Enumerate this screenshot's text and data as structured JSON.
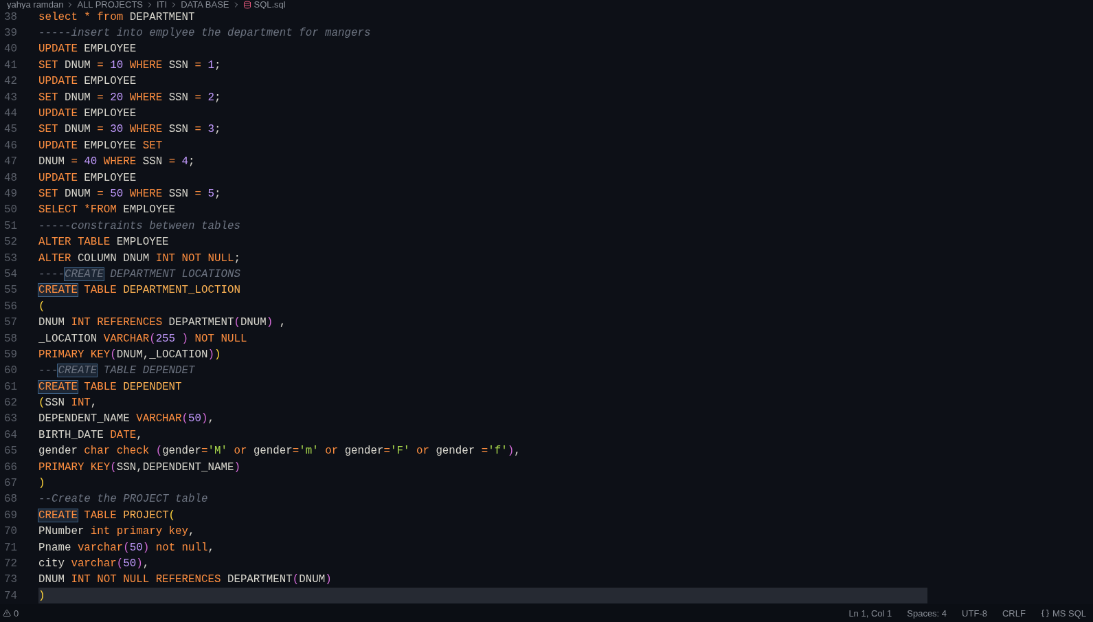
{
  "breadcrumb": [
    "yahya ramdan",
    "ALL PROJECTS",
    "ITI",
    "DATA BASE",
    "SQL.sql"
  ],
  "lines": [
    {
      "number": "38",
      "current": false,
      "tokens": [
        {
          "kind": "keyword",
          "text": "select * from"
        },
        {
          "kind": "ident",
          "text": " DEPARTMENT"
        }
      ]
    },
    {
      "number": "39",
      "current": false,
      "tokens": [
        {
          "kind": "comment",
          "text": "-----insert into emplyee the department for mangers"
        }
      ]
    },
    {
      "number": "40",
      "current": false,
      "tokens": [
        {
          "kind": "keyword",
          "text": "UPDATE"
        },
        {
          "kind": "ident",
          "text": " EMPLOYEE"
        }
      ]
    },
    {
      "number": "41",
      "current": false,
      "tokens": [
        {
          "kind": "keyword",
          "text": "SET"
        },
        {
          "kind": "ident",
          "text": " DNUM "
        },
        {
          "kind": "keyword",
          "text": "="
        },
        {
          "kind": "number",
          "text": " 10 "
        },
        {
          "kind": "keyword",
          "text": "WHERE"
        },
        {
          "kind": "ident",
          "text": " SSN "
        },
        {
          "kind": "keyword",
          "text": "="
        },
        {
          "kind": "number",
          "text": " 1"
        },
        {
          "kind": "ident",
          "text": ";"
        }
      ]
    },
    {
      "number": "42",
      "current": false,
      "tokens": [
        {
          "kind": "keyword",
          "text": "UPDATE"
        },
        {
          "kind": "ident",
          "text": " EMPLOYEE"
        }
      ]
    },
    {
      "number": "43",
      "current": false,
      "tokens": [
        {
          "kind": "keyword",
          "text": "SET"
        },
        {
          "kind": "ident",
          "text": " DNUM "
        },
        {
          "kind": "keyword",
          "text": "="
        },
        {
          "kind": "number",
          "text": " 20 "
        },
        {
          "kind": "keyword",
          "text": "WHERE"
        },
        {
          "kind": "ident",
          "text": " SSN "
        },
        {
          "kind": "keyword",
          "text": "="
        },
        {
          "kind": "number",
          "text": " 2"
        },
        {
          "kind": "ident",
          "text": ";"
        }
      ]
    },
    {
      "number": "44",
      "current": false,
      "tokens": [
        {
          "kind": "keyword",
          "text": "UPDATE"
        },
        {
          "kind": "ident",
          "text": " EMPLOYEE"
        }
      ]
    },
    {
      "number": "45",
      "current": false,
      "tokens": [
        {
          "kind": "keyword",
          "text": "SET"
        },
        {
          "kind": "ident",
          "text": " DNUM "
        },
        {
          "kind": "keyword",
          "text": "="
        },
        {
          "kind": "number",
          "text": " 30 "
        },
        {
          "kind": "keyword",
          "text": "WHERE"
        },
        {
          "kind": "ident",
          "text": " SSN "
        },
        {
          "kind": "keyword",
          "text": "="
        },
        {
          "kind": "number",
          "text": " 3"
        },
        {
          "kind": "ident",
          "text": ";"
        }
      ]
    },
    {
      "number": "46",
      "current": false,
      "tokens": [
        {
          "kind": "keyword",
          "text": "UPDATE"
        },
        {
          "kind": "ident",
          "text": " EMPLOYEE "
        },
        {
          "kind": "keyword",
          "text": "SET"
        }
      ]
    },
    {
      "number": "47",
      "current": false,
      "tokens": [
        {
          "kind": "ident",
          "text": "DNUM "
        },
        {
          "kind": "keyword",
          "text": "="
        },
        {
          "kind": "number",
          "text": " 40 "
        },
        {
          "kind": "keyword",
          "text": "WHERE"
        },
        {
          "kind": "ident",
          "text": " SSN "
        },
        {
          "kind": "keyword",
          "text": "="
        },
        {
          "kind": "number",
          "text": " 4"
        },
        {
          "kind": "ident",
          "text": ";"
        }
      ]
    },
    {
      "number": "48",
      "current": false,
      "tokens": [
        {
          "kind": "keyword",
          "text": "UPDATE"
        },
        {
          "kind": "ident",
          "text": " EMPLOYEE"
        }
      ]
    },
    {
      "number": "49",
      "current": false,
      "tokens": [
        {
          "kind": "keyword",
          "text": "SET"
        },
        {
          "kind": "ident",
          "text": " DNUM "
        },
        {
          "kind": "keyword",
          "text": "="
        },
        {
          "kind": "number",
          "text": " 50 "
        },
        {
          "kind": "keyword",
          "text": "WHERE"
        },
        {
          "kind": "ident",
          "text": " SSN "
        },
        {
          "kind": "keyword",
          "text": "="
        },
        {
          "kind": "number",
          "text": " 5"
        },
        {
          "kind": "ident",
          "text": ";"
        }
      ]
    },
    {
      "number": "50",
      "current": false,
      "tokens": [
        {
          "kind": "keyword",
          "text": "SELECT *FROM"
        },
        {
          "kind": "ident",
          "text": " EMPLOYEE"
        }
      ]
    },
    {
      "number": "51",
      "current": false,
      "tokens": [
        {
          "kind": "comment",
          "text": "-----constraints between tables"
        }
      ]
    },
    {
      "number": "52",
      "current": false,
      "tokens": [
        {
          "kind": "keyword",
          "text": "ALTER TABLE"
        },
        {
          "kind": "ident",
          "text": " EMPLOYEE"
        }
      ]
    },
    {
      "number": "53",
      "current": false,
      "tokens": [
        {
          "kind": "keyword",
          "text": "ALTER"
        },
        {
          "kind": "ident",
          "text": " COLUMN DNUM "
        },
        {
          "kind": "keyword",
          "text": "INT NOT NULL"
        },
        {
          "kind": "ident",
          "text": ";"
        }
      ]
    },
    {
      "number": "54",
      "current": false,
      "tokens": [
        {
          "kind": "comment",
          "text": "----"
        },
        {
          "kind": "comment-match",
          "text": "CREATE"
        },
        {
          "kind": "comment",
          "text": " DEPARTMENT LOCATIONS"
        }
      ]
    },
    {
      "number": "55",
      "current": false,
      "tokens": [
        {
          "kind": "keyword-match",
          "text": "CREATE"
        },
        {
          "kind": "keyword",
          "text": " TABLE "
        },
        {
          "kind": "name",
          "text": "DEPARTMENT_LOCTION"
        }
      ]
    },
    {
      "number": "56",
      "current": false,
      "tokens": [
        {
          "kind": "bracket-outer",
          "text": "("
        }
      ]
    },
    {
      "number": "57",
      "current": false,
      "tokens": [
        {
          "kind": "ident",
          "text": "DNUM "
        },
        {
          "kind": "keyword",
          "text": "INT REFERENCES"
        },
        {
          "kind": "ident",
          "text": " DEPARTMENT"
        },
        {
          "kind": "bracket-inner",
          "text": "("
        },
        {
          "kind": "ident",
          "text": "DNUM"
        },
        {
          "kind": "bracket-inner",
          "text": ")"
        },
        {
          "kind": "ident",
          "text": " ,"
        }
      ]
    },
    {
      "number": "58",
      "current": false,
      "tokens": [
        {
          "kind": "ident",
          "text": "_LOCATION "
        },
        {
          "kind": "keyword",
          "text": "VARCHAR"
        },
        {
          "kind": "bracket-inner",
          "text": "("
        },
        {
          "kind": "number",
          "text": "255 "
        },
        {
          "kind": "bracket-inner",
          "text": ")"
        },
        {
          "kind": "keyword",
          "text": " NOT NULL"
        }
      ]
    },
    {
      "number": "59",
      "current": false,
      "tokens": [
        {
          "kind": "keyword",
          "text": "PRIMARY KEY"
        },
        {
          "kind": "bracket-inner",
          "text": "("
        },
        {
          "kind": "ident",
          "text": "DNUM,_LOCATION"
        },
        {
          "kind": "bracket-inner",
          "text": ")"
        },
        {
          "kind": "bracket-outer",
          "text": ")"
        }
      ]
    },
    {
      "number": "60",
      "current": false,
      "tokens": [
        {
          "kind": "comment",
          "text": "---"
        },
        {
          "kind": "comment-match",
          "text": "CREATE"
        },
        {
          "kind": "comment",
          "text": " TABLE DEPENDET"
        }
      ]
    },
    {
      "number": "61",
      "current": false,
      "tokens": [
        {
          "kind": "keyword-match",
          "text": "CREATE"
        },
        {
          "kind": "keyword",
          "text": " TABLE "
        },
        {
          "kind": "name",
          "text": "DEPENDENT"
        }
      ]
    },
    {
      "number": "62",
      "current": false,
      "tokens": [
        {
          "kind": "bracket-outer",
          "text": "("
        },
        {
          "kind": "ident",
          "text": "SSN "
        },
        {
          "kind": "keyword",
          "text": "INT"
        },
        {
          "kind": "ident",
          "text": ","
        }
      ]
    },
    {
      "number": "63",
      "current": false,
      "tokens": [
        {
          "kind": "ident",
          "text": "DEPENDENT_NAME "
        },
        {
          "kind": "keyword",
          "text": "VARCHAR"
        },
        {
          "kind": "bracket-inner",
          "text": "("
        },
        {
          "kind": "number",
          "text": "50"
        },
        {
          "kind": "bracket-inner",
          "text": ")"
        },
        {
          "kind": "ident",
          "text": ","
        }
      ]
    },
    {
      "number": "64",
      "current": false,
      "tokens": [
        {
          "kind": "ident",
          "text": "BIRTH_DATE "
        },
        {
          "kind": "keyword",
          "text": "DATE"
        },
        {
          "kind": "ident",
          "text": ","
        }
      ]
    },
    {
      "number": "65",
      "current": false,
      "tokens": [
        {
          "kind": "ident",
          "text": "gender "
        },
        {
          "kind": "keyword",
          "text": "char check "
        },
        {
          "kind": "bracket-inner",
          "text": "("
        },
        {
          "kind": "ident",
          "text": "gender"
        },
        {
          "kind": "keyword",
          "text": "="
        },
        {
          "kind": "string",
          "text": "'M'"
        },
        {
          "kind": "keyword",
          "text": " or "
        },
        {
          "kind": "ident",
          "text": "gender"
        },
        {
          "kind": "keyword",
          "text": "="
        },
        {
          "kind": "string",
          "text": "'m'"
        },
        {
          "kind": "keyword",
          "text": " or "
        },
        {
          "kind": "ident",
          "text": "gender"
        },
        {
          "kind": "keyword",
          "text": "="
        },
        {
          "kind": "string",
          "text": "'F'"
        },
        {
          "kind": "keyword",
          "text": " or "
        },
        {
          "kind": "ident",
          "text": "gender "
        },
        {
          "kind": "keyword",
          "text": "="
        },
        {
          "kind": "string",
          "text": "'f'"
        },
        {
          "kind": "bracket-inner",
          "text": ")"
        },
        {
          "kind": "ident",
          "text": ","
        }
      ]
    },
    {
      "number": "66",
      "current": false,
      "tokens": [
        {
          "kind": "keyword",
          "text": "PRIMARY KEY"
        },
        {
          "kind": "bracket-inner",
          "text": "("
        },
        {
          "kind": "ident",
          "text": "SSN,DEPENDENT_NAME"
        },
        {
          "kind": "bracket-inner",
          "text": ")"
        }
      ]
    },
    {
      "number": "67",
      "current": false,
      "tokens": [
        {
          "kind": "bracket-outer",
          "text": ")"
        }
      ]
    },
    {
      "number": "68",
      "current": false,
      "tokens": [
        {
          "kind": "comment",
          "text": "--Create the PROJECT table"
        }
      ]
    },
    {
      "number": "69",
      "current": false,
      "tokens": [
        {
          "kind": "keyword-match",
          "text": "CREATE"
        },
        {
          "kind": "keyword",
          "text": " TABLE "
        },
        {
          "kind": "name",
          "text": "PROJECT"
        },
        {
          "kind": "bracket-outer",
          "text": "("
        }
      ]
    },
    {
      "number": "70",
      "current": false,
      "tokens": [
        {
          "kind": "ident",
          "text": "PNumber "
        },
        {
          "kind": "keyword",
          "text": "int primary key"
        },
        {
          "kind": "ident",
          "text": ","
        }
      ]
    },
    {
      "number": "71",
      "current": false,
      "tokens": [
        {
          "kind": "ident",
          "text": "Pname "
        },
        {
          "kind": "keyword",
          "text": "varchar"
        },
        {
          "kind": "bracket-inner",
          "text": "("
        },
        {
          "kind": "number",
          "text": "50"
        },
        {
          "kind": "bracket-inner",
          "text": ")"
        },
        {
          "kind": "keyword",
          "text": " not null"
        },
        {
          "kind": "ident",
          "text": ","
        }
      ]
    },
    {
      "number": "72",
      "current": false,
      "tokens": [
        {
          "kind": "ident",
          "text": "city "
        },
        {
          "kind": "keyword",
          "text": "varchar"
        },
        {
          "kind": "bracket-inner",
          "text": "("
        },
        {
          "kind": "number",
          "text": "50"
        },
        {
          "kind": "bracket-inner",
          "text": ")"
        },
        {
          "kind": "ident",
          "text": ","
        }
      ]
    },
    {
      "number": "73",
      "current": false,
      "tokens": [
        {
          "kind": "ident",
          "text": "DNUM "
        },
        {
          "kind": "keyword",
          "text": "INT NOT NULL REFERENCES"
        },
        {
          "kind": "ident",
          "text": " DEPARTMENT"
        },
        {
          "kind": "bracket-inner",
          "text": "("
        },
        {
          "kind": "ident",
          "text": "DNUM"
        },
        {
          "kind": "bracket-inner",
          "text": ")"
        }
      ]
    },
    {
      "number": "74",
      "current": true,
      "tokens": [
        {
          "kind": "bracket-outer",
          "text": ")"
        }
      ]
    }
  ],
  "status_bar": {
    "problems": "0",
    "items": [
      "Ln 1, Col 1",
      "Spaces: 4",
      "UTF-8",
      "CRLF",
      "MS SQL"
    ]
  }
}
